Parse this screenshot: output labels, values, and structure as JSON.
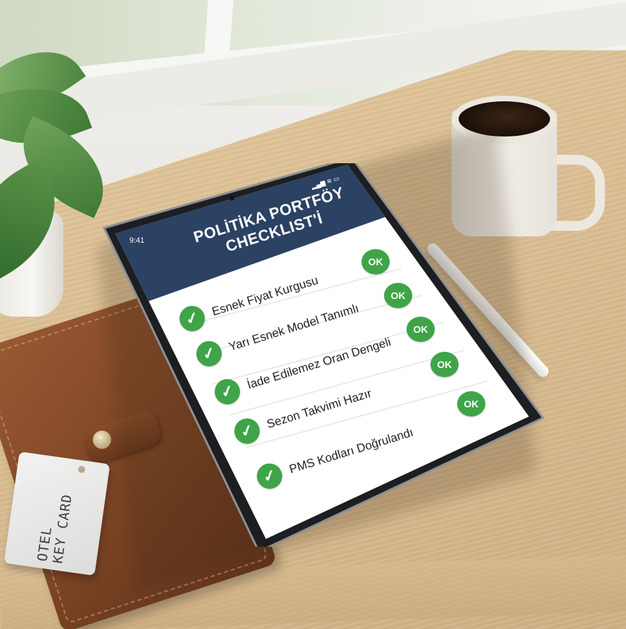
{
  "status_bar": {
    "time": "9:41",
    "icons": "▂▄▆ ≋ ▭"
  },
  "checklist": {
    "title_line1": "POLİTİKA PORTFÖY",
    "title_line2": "CHECKLIST'İ",
    "items": [
      {
        "label": "Esnek Fiyat Kurgusu",
        "badge": "OK"
      },
      {
        "label": "Yarı Esnek Model Tanımlı",
        "badge": "OK"
      },
      {
        "label": "İade Edilemez Oran Dengeli",
        "badge": "OK"
      },
      {
        "label": "Sezon Takvimi Hazır",
        "badge": "OK"
      },
      {
        "label": "PMS Kodları Doğrulandı",
        "badge": "OK"
      }
    ],
    "check_glyph": "✓"
  },
  "key_card": {
    "line1": "OTEL",
    "line2": "KEY CARD"
  },
  "colors": {
    "header": "#2c4263",
    "check": "#3fa447",
    "screen": "#ffffff",
    "bezel": "#1d1e21"
  }
}
